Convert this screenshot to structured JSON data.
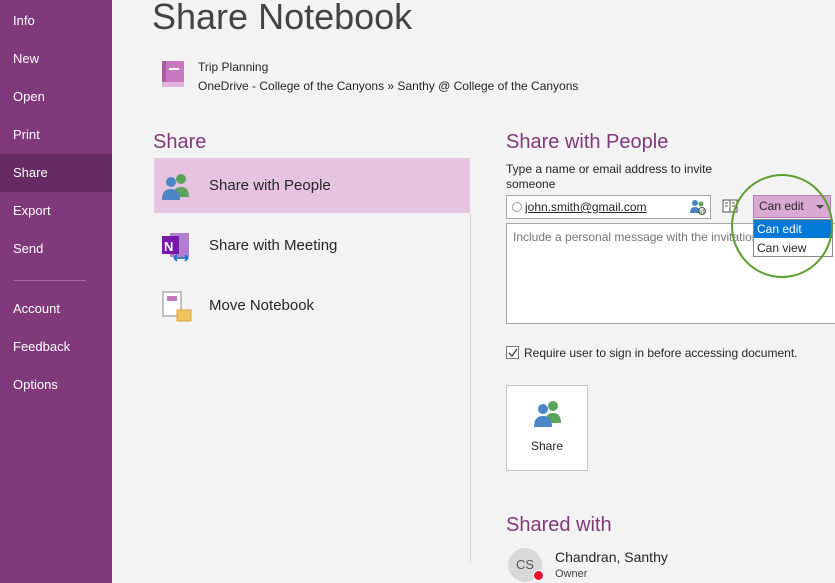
{
  "sidebar": {
    "items": [
      {
        "label": "Info"
      },
      {
        "label": "New"
      },
      {
        "label": "Open"
      },
      {
        "label": "Print"
      },
      {
        "label": "Share"
      },
      {
        "label": "Export"
      },
      {
        "label": "Send"
      },
      {
        "label": "Account"
      },
      {
        "label": "Feedback"
      },
      {
        "label": "Options"
      }
    ],
    "active_item": "Share"
  },
  "page": {
    "title": "Share Notebook"
  },
  "notebook": {
    "name": "Trip Planning",
    "path": "OneDrive - College of the Canyons » Santhy @ College of the Canyons",
    "icon": "notebook-icon"
  },
  "share_section": {
    "heading": "Share",
    "options": [
      {
        "label": "Share with People",
        "icon": "people-icon",
        "selected": true
      },
      {
        "label": "Share with Meeting",
        "icon": "onenote-meeting-icon",
        "selected": false
      },
      {
        "label": "Move Notebook",
        "icon": "move-notebook-icon",
        "selected": false
      }
    ]
  },
  "share_with_people": {
    "heading": "Share with People",
    "invite_label": "Type a name or email address to invite someone",
    "invite_value": "john.smith@gmail.com",
    "permission": {
      "selected": "Can edit",
      "options": [
        "Can edit",
        "Can view"
      ],
      "highlighted": "Can edit"
    },
    "message_placeholder": "Include a personal message with the invitation",
    "require_signin": {
      "checked": true,
      "label": "Require user to sign in before accessing document."
    },
    "share_button_label": "Share"
  },
  "shared_with": {
    "heading": "Shared with",
    "people": [
      {
        "initials": "CS",
        "name": "Chandran, Santhy",
        "role": "Owner",
        "presence": "busy"
      }
    ]
  },
  "colors": {
    "sidebar": "#80397b",
    "sidebar_active": "#672b63",
    "accent": "#80397b",
    "selected_option": "#e6c3e0",
    "permission_select": "#d9a9d3",
    "highlight": "#0078d7",
    "annotation_circle": "#5a9e2f",
    "presence_busy": "#e8112d"
  }
}
